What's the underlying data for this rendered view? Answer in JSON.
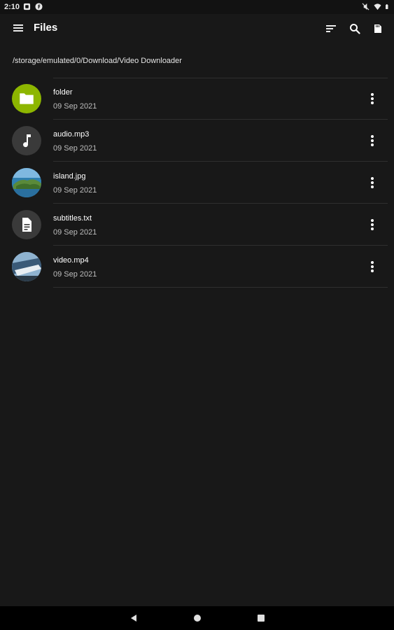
{
  "status_bar": {
    "time": "2:10"
  },
  "toolbar": {
    "title": "Files"
  },
  "path": "/storage/emulated/0/Download/Video Downloader",
  "files": [
    {
      "name": "folder",
      "date": "09 Sep 2021",
      "icon": "folder-icon",
      "color": "#8db600"
    },
    {
      "name": "audio.mp3",
      "date": "09 Sep 2021",
      "icon": "music-note-icon",
      "color": "#3a3a3a"
    },
    {
      "name": "island.jpg",
      "date": "09 Sep 2021",
      "icon": "island-thumbnail",
      "color": "#3a8fc4"
    },
    {
      "name": "subtitles.txt",
      "date": "09 Sep 2021",
      "icon": "document-icon",
      "color": "#3a3a3a"
    },
    {
      "name": "video.mp4",
      "date": "09 Sep 2021",
      "icon": "video-thumbnail",
      "color": "#6a8fb0"
    }
  ],
  "colors": {
    "background": "#181818",
    "folder_accent": "#8db600",
    "divider": "#2e2e2e"
  }
}
